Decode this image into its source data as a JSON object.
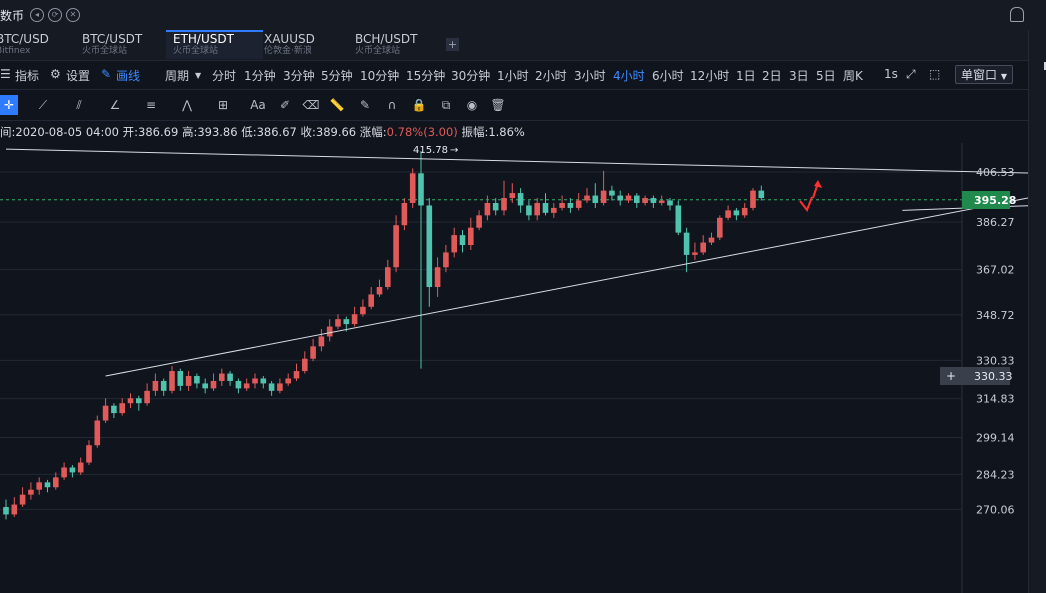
{
  "window": {
    "title": "数币"
  },
  "tabs": [
    {
      "symbol": "BTC/USD",
      "source": "Bitfinex",
      "active": false
    },
    {
      "symbol": "BTC/USDT",
      "source": "火币全球站",
      "active": false
    },
    {
      "symbol": "ETH/USDT",
      "source": "火币全球站",
      "active": true
    },
    {
      "symbol": "XAUUSD",
      "source": "伦敦金·新浪",
      "active": false
    },
    {
      "symbol": "BCH/USDT",
      "source": "火币全球站",
      "active": false
    }
  ],
  "toolbar": {
    "indicator": "指标",
    "settings": "设置",
    "draw": "画线",
    "period": "周期",
    "intervals": [
      "分时",
      "1分钟",
      "3分钟",
      "5分钟",
      "10分钟",
      "15分钟",
      "30分钟",
      "1小时",
      "2小时",
      "3小时",
      "4小时",
      "6小时",
      "12小时",
      "1日",
      "2日",
      "3日",
      "5日",
      "周K",
      "1s"
    ],
    "active_interval": "4小时",
    "window_mode": "单窗口"
  },
  "info": {
    "time": "间:2020-08-05 04:00",
    "open": "开:386.69",
    "high": "高:393.86",
    "low": "低:386.67",
    "close": "收:389.66",
    "change_label": "涨幅:",
    "change_value": "0.78%(3.00)",
    "amplitude": "振幅:1.86%"
  },
  "chart_data": {
    "type": "candlestick",
    "price_ticks": [
      406.53,
      386.27,
      367.02,
      348.72,
      330.33,
      314.83,
      299.14,
      284.23,
      270.06
    ],
    "current_price": "395.28",
    "crosshair_price": "330.33",
    "peak_label": "415.78",
    "ylim": [
      265,
      418
    ],
    "up_color": "#e05a5a",
    "down_color": "#4fc3ad",
    "candles": [
      [
        271,
        268,
        274,
        266
      ],
      [
        268,
        272,
        275,
        267
      ],
      [
        272,
        276,
        279,
        271
      ],
      [
        276,
        278,
        281,
        274
      ],
      [
        278,
        281,
        283,
        276
      ],
      [
        281,
        279,
        282,
        277
      ],
      [
        279,
        283,
        285,
        278
      ],
      [
        283,
        287,
        289,
        282
      ],
      [
        287,
        285,
        288,
        283
      ],
      [
        285,
        289,
        291,
        284
      ],
      [
        289,
        296,
        298,
        288
      ],
      [
        296,
        306,
        308,
        295
      ],
      [
        306,
        312,
        315,
        305
      ],
      [
        312,
        309,
        313,
        307
      ],
      [
        309,
        313,
        315,
        308
      ],
      [
        313,
        315,
        317,
        311
      ],
      [
        315,
        313,
        316,
        310
      ],
      [
        313,
        318,
        321,
        312
      ],
      [
        318,
        322,
        325,
        316
      ],
      [
        322,
        318,
        323,
        316
      ],
      [
        318,
        326,
        328,
        317
      ],
      [
        326,
        320,
        327,
        318
      ],
      [
        320,
        324,
        326,
        318
      ],
      [
        324,
        321,
        325,
        319
      ],
      [
        321,
        319,
        323,
        317
      ],
      [
        319,
        322,
        325,
        318
      ],
      [
        322,
        325,
        327,
        320
      ],
      [
        325,
        322,
        326,
        320
      ],
      [
        322,
        319,
        323,
        317
      ],
      [
        319,
        321,
        323,
        318
      ],
      [
        321,
        323,
        325,
        319
      ],
      [
        323,
        321,
        324,
        319
      ],
      [
        321,
        318,
        322,
        316
      ],
      [
        318,
        321,
        323,
        317
      ],
      [
        321,
        323,
        325,
        320
      ],
      [
        323,
        326,
        329,
        322
      ],
      [
        326,
        331,
        334,
        325
      ],
      [
        331,
        336,
        339,
        330
      ],
      [
        336,
        340,
        343,
        334
      ],
      [
        340,
        344,
        347,
        338
      ],
      [
        344,
        347,
        349,
        343
      ],
      [
        347,
        345,
        348,
        342
      ],
      [
        345,
        349,
        352,
        344
      ],
      [
        349,
        352,
        355,
        348
      ],
      [
        352,
        357,
        360,
        351
      ],
      [
        357,
        360,
        363,
        356
      ],
      [
        360,
        368,
        371,
        359
      ],
      [
        368,
        385,
        389,
        366
      ],
      [
        385,
        394,
        396,
        383
      ],
      [
        394,
        406,
        408,
        392
      ],
      [
        406,
        393,
        415,
        327
      ],
      [
        393,
        360,
        396,
        352
      ],
      [
        360,
        368,
        372,
        356
      ],
      [
        368,
        374,
        377,
        366
      ],
      [
        374,
        381,
        384,
        372
      ],
      [
        381,
        377,
        383,
        374
      ],
      [
        377,
        384,
        388,
        375
      ],
      [
        384,
        389,
        391,
        383
      ],
      [
        389,
        394,
        397,
        387
      ],
      [
        394,
        391,
        396,
        389
      ],
      [
        391,
        396,
        403,
        389
      ],
      [
        396,
        398,
        402,
        394
      ],
      [
        398,
        393,
        400,
        390
      ],
      [
        393,
        389,
        395,
        387
      ],
      [
        389,
        394,
        396,
        387
      ],
      [
        394,
        390,
        398,
        389
      ],
      [
        390,
        392,
        394,
        388
      ],
      [
        392,
        394,
        397,
        391
      ],
      [
        394,
        392,
        396,
        390
      ],
      [
        392,
        395,
        398,
        391
      ],
      [
        395,
        397,
        400,
        394
      ],
      [
        397,
        394,
        402,
        392
      ],
      [
        394,
        399,
        407,
        393
      ],
      [
        399,
        397,
        401,
        395
      ],
      [
        397,
        395,
        399,
        393
      ],
      [
        395,
        397,
        398,
        394
      ],
      [
        397,
        394,
        398,
        392
      ],
      [
        394,
        396,
        397,
        393
      ],
      [
        396,
        394,
        397,
        392
      ],
      [
        394,
        395,
        397,
        393
      ],
      [
        395,
        393,
        396,
        391
      ],
      [
        393,
        382,
        395,
        381
      ],
      [
        382,
        373,
        384,
        366
      ],
      [
        373,
        374,
        378,
        371
      ],
      [
        374,
        378,
        381,
        373
      ],
      [
        378,
        380,
        382,
        377
      ],
      [
        380,
        388,
        389,
        379
      ],
      [
        388,
        391,
        393,
        387
      ],
      [
        391,
        389,
        392,
        387
      ],
      [
        389,
        392,
        394,
        388
      ],
      [
        392,
        399,
        400,
        391
      ],
      [
        399,
        396,
        401,
        395
      ]
    ],
    "trendlines": [
      {
        "from": [
          0,
          415.78
        ],
        "to": [
          137.5,
          405
        ]
      },
      {
        "from": [
          12,
          324
        ],
        "to": [
          137,
          405
        ]
      },
      {
        "from": [
          108,
          391
        ],
        "to": [
          132,
          394
        ]
      }
    ]
  }
}
